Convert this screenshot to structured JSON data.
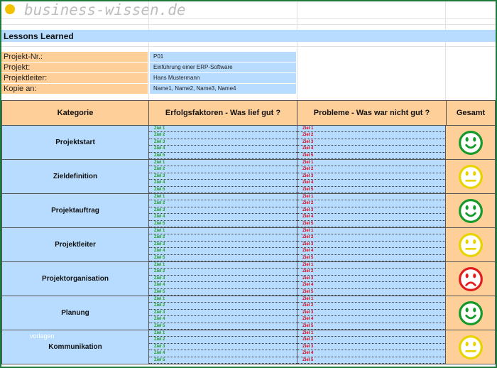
{
  "brand": {
    "text": "business-wissen.de",
    "icon": "sun-logo-icon"
  },
  "sheet": {
    "title": "Lessons Learned",
    "info": [
      {
        "label": "Projekt-Nr.:",
        "value": "P01"
      },
      {
        "label": "Projekt:",
        "value": "Einführung einer ERP-Software"
      },
      {
        "label": "Projektleiter:",
        "value": "Hans Mustermann"
      },
      {
        "label": "Kopie an:",
        "value": "Name1, Name2, Name3, Name4"
      }
    ],
    "headers": {
      "kategorie": "Kategorie",
      "erfolg": "Erfolgsfaktoren - Was lief gut ?",
      "probleme": "Probleme - Was war nicht gut ?",
      "gesamt": "Gesamt"
    },
    "ziel_labels": [
      "Ziel 1",
      "Ziel 2",
      "Ziel 3",
      "Ziel 4",
      "Ziel 5"
    ],
    "rows": [
      {
        "category": "Projektstart",
        "rating": "happy"
      },
      {
        "category": "Zieldefinition",
        "rating": "neutral"
      },
      {
        "category": "Projektauftrag",
        "rating": "happy"
      },
      {
        "category": "Projektleiter",
        "rating": "neutral"
      },
      {
        "category": "Projektorganisation",
        "rating": "sad"
      },
      {
        "category": "Planung",
        "rating": "happy"
      },
      {
        "category": "Kommunikation",
        "rating": "neutral"
      }
    ],
    "watermark": "vorlagen"
  },
  "colors": {
    "happy": "#169a2a",
    "neutral": "#e8d400",
    "sad": "#e11d1d",
    "ok_text": "#1f9a1f",
    "bad_text": "#d2000f",
    "blue_cell": "#b8dcff",
    "orange_cell": "#ffcf99"
  }
}
